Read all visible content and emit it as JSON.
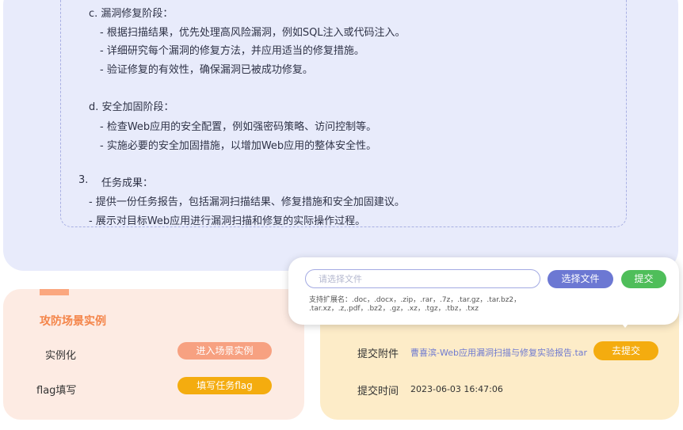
{
  "task": {
    "lines": [
      "c. 漏洞修复阶段：",
      "- 根据扫描结果，优先处理高风险漏洞，例如SQL注入或代码注入。",
      "- 详细研究每个漏洞的修复方法，并应用适当的修复措施。",
      "- 验证修复的有效性，确保漏洞已被成功修复。",
      "d. 安全加固阶段：",
      "- 检查Web应用的安全配置，例如强密码策略、访问控制等。",
      "- 实施必要的安全加固措施，以增加Web应用的整体安全性。",
      "3.",
      "任务成果：",
      "- 提供一份任务报告，包括漏洞扫描结果、修复措施和安全加固建议。",
      "- 展示对目标Web应用进行漏洞扫描和修复的实际操作过程。"
    ]
  },
  "scene": {
    "title": "攻防场景实例",
    "instance_label": "实例化",
    "enter_button": "进入场景实例",
    "flag_label": "flag填写",
    "flag_button": "填写任务flag"
  },
  "submit": {
    "attachment_label": "提交附件",
    "attachment_file": "曹喜滨-Web应用漏洞扫描与修复实验报告.tar",
    "go_submit_button": "去提交",
    "time_label": "提交时间",
    "time_value": "2023-06-03 16:47:06"
  },
  "popup": {
    "file_placeholder": "请选择文件",
    "choose_button": "选择文件",
    "submit_button": "提交",
    "extensions_line1": "支持扩展名：.doc，.docx，.zip，.rar，.7z，.tar.gz，.tar.bz2，",
    "extensions_line2": ".tar.xz，.z,.pdf，.bz2，.gz，.xz，.tgz，.tbz，.txz"
  },
  "colors": {
    "task_bg": "#e8ebfb",
    "scene_bg": "#fdebe3",
    "scene_accent": "#f4854a",
    "submit_bg": "#fdecc8",
    "yellow_button": "#f4ac0f",
    "salmon_button": "#f7a181",
    "blue_button": "#6c78d3",
    "green_button": "#4fbe5a",
    "link": "#6f7ad0"
  }
}
